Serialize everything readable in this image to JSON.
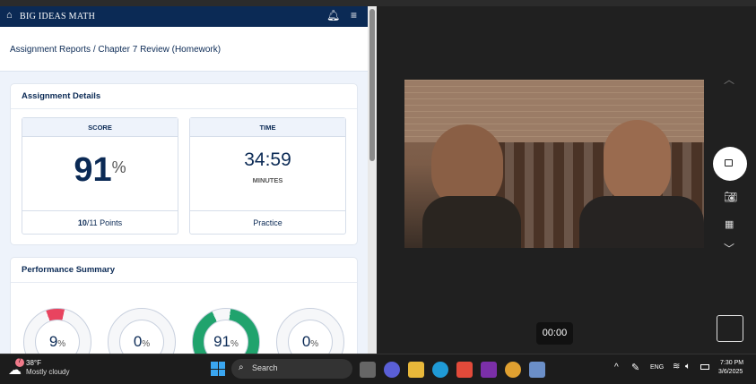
{
  "app": {
    "brand": "BIG IDEAS MATH",
    "breadcrumb": "Assignment Reports / Chapter 7 Review (Homework)"
  },
  "details": {
    "title": "Assignment Details",
    "score": {
      "label": "SCORE",
      "value": "91",
      "unit": "%",
      "points_earned": "10",
      "points_total": "/11 Points"
    },
    "time": {
      "label": "TIME",
      "value": "34:59",
      "unit": "MINUTES",
      "mode": "Practice"
    }
  },
  "performance": {
    "title": "Performance Summary",
    "rings": [
      {
        "value": "9",
        "unit": "%",
        "percent": 9,
        "color": "#e8445f"
      },
      {
        "value": "0",
        "unit": "%",
        "percent": 0,
        "color": "#cccccc"
      },
      {
        "value": "91",
        "unit": "%",
        "percent": 91,
        "color": "#20a36d"
      },
      {
        "value": "0",
        "unit": "%",
        "percent": 0,
        "color": "#cccccc"
      }
    ]
  },
  "camera": {
    "timer": "00:00"
  },
  "taskbar": {
    "temp": "38°F",
    "weather": "Mostly cloudy",
    "weather_badge": "7",
    "search": "Search",
    "lang": "ENG",
    "time": "7:30 PM",
    "date": "3/6/2025"
  }
}
